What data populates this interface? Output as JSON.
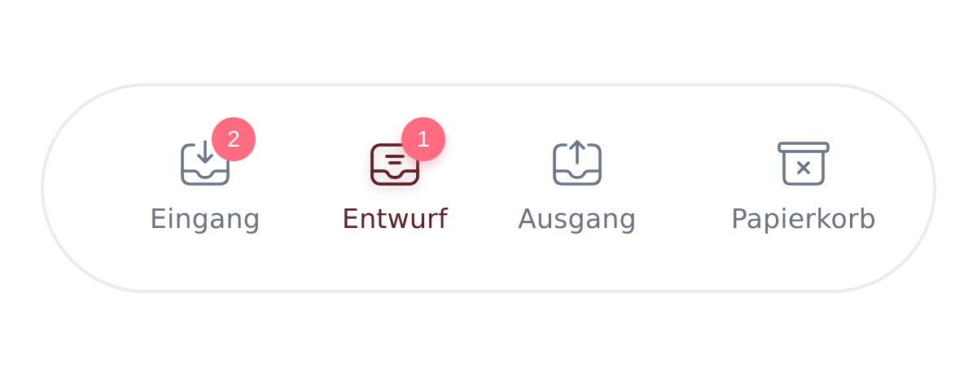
{
  "nav": {
    "items": [
      {
        "label": "Eingang",
        "icon": "inbox-download-icon",
        "badge": "2",
        "active": false
      },
      {
        "label": "Entwurf",
        "icon": "drafts-tray-icon",
        "badge": "1",
        "active": true
      },
      {
        "label": "Ausgang",
        "icon": "outbox-upload-icon",
        "badge": "",
        "active": false
      },
      {
        "label": "Papierkorb",
        "icon": "trash-bin-icon",
        "badge": "",
        "active": false
      }
    ]
  },
  "colors": {
    "badge": "#ff6b81",
    "active_label": "#5e1f26",
    "inactive_label": "#6b7280",
    "pill_border": "#ececec"
  }
}
